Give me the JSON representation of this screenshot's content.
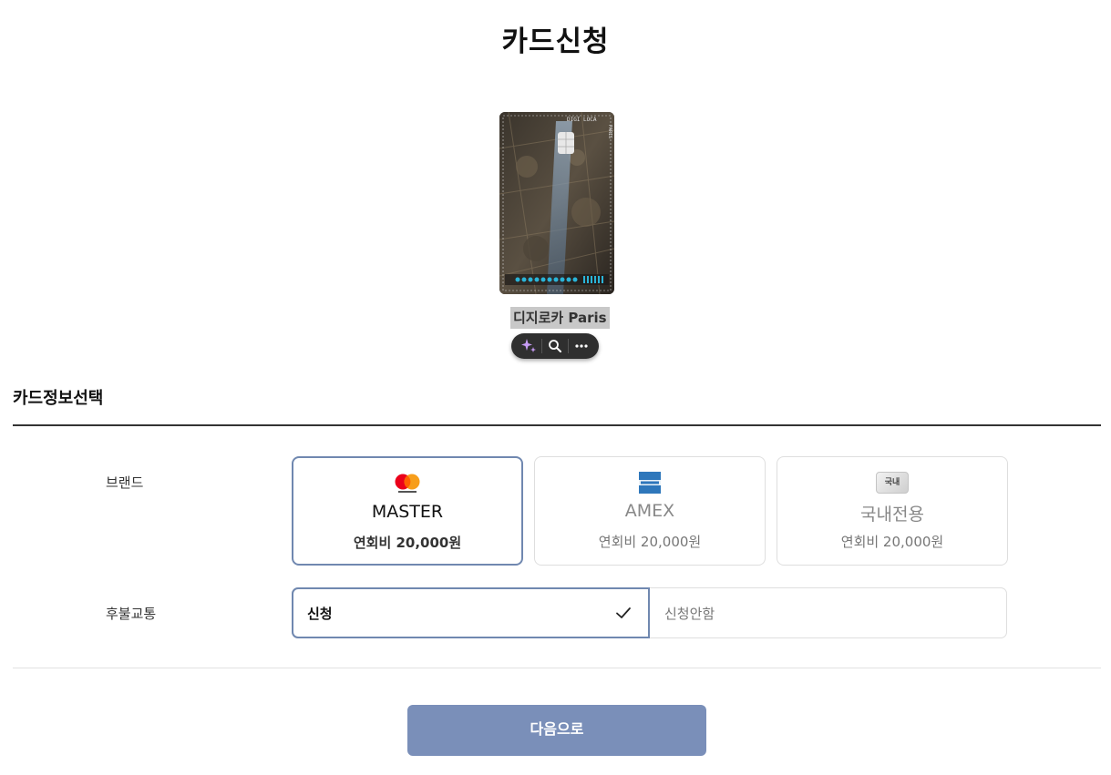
{
  "page": {
    "title": "카드신청"
  },
  "card": {
    "name": "디지로카 Paris",
    "brand_text": "DIGI LOCA",
    "city_text": "PARIS"
  },
  "toolbar": {
    "icons": [
      "sparkle-icon",
      "search-icon",
      "more-icon"
    ]
  },
  "section": {
    "title": "카드정보선택"
  },
  "brand": {
    "label": "브랜드",
    "options": [
      {
        "name": "MASTER",
        "fee": "연회비 20,000원",
        "selected": true,
        "logo": "mastercard-logo"
      },
      {
        "name": "AMEX",
        "fee": "연회비 20,000원",
        "selected": false,
        "logo": "amex-logo"
      },
      {
        "name": "국내전용",
        "fee": "연회비 20,000원",
        "selected": false,
        "logo": "domestic-logo",
        "logo_text": "국내"
      }
    ]
  },
  "transit": {
    "label": "후불교통",
    "options": [
      {
        "label": "신청",
        "selected": true
      },
      {
        "label": "신청안함",
        "selected": false
      }
    ]
  },
  "next_button": {
    "label": "다음으로"
  },
  "colors": {
    "accent_border": "#7088b0",
    "button_bg": "#7a8fb9",
    "divider": "#333333"
  }
}
